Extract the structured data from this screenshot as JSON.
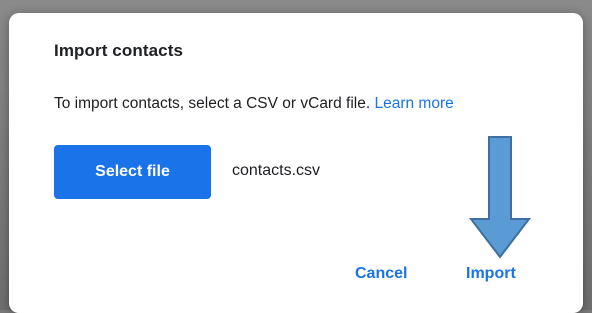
{
  "dialog": {
    "title": "Import contacts",
    "description": "To import contacts, select a CSV or vCard file.",
    "learn_more_label": "Learn more",
    "select_file_label": "Select file",
    "selected_file_name": "contacts.csv",
    "annotation_arrow_color": "#5b9bd5",
    "actions": {
      "cancel_label": "Cancel",
      "import_label": "Import"
    },
    "accent_color": "#1a73e8"
  }
}
